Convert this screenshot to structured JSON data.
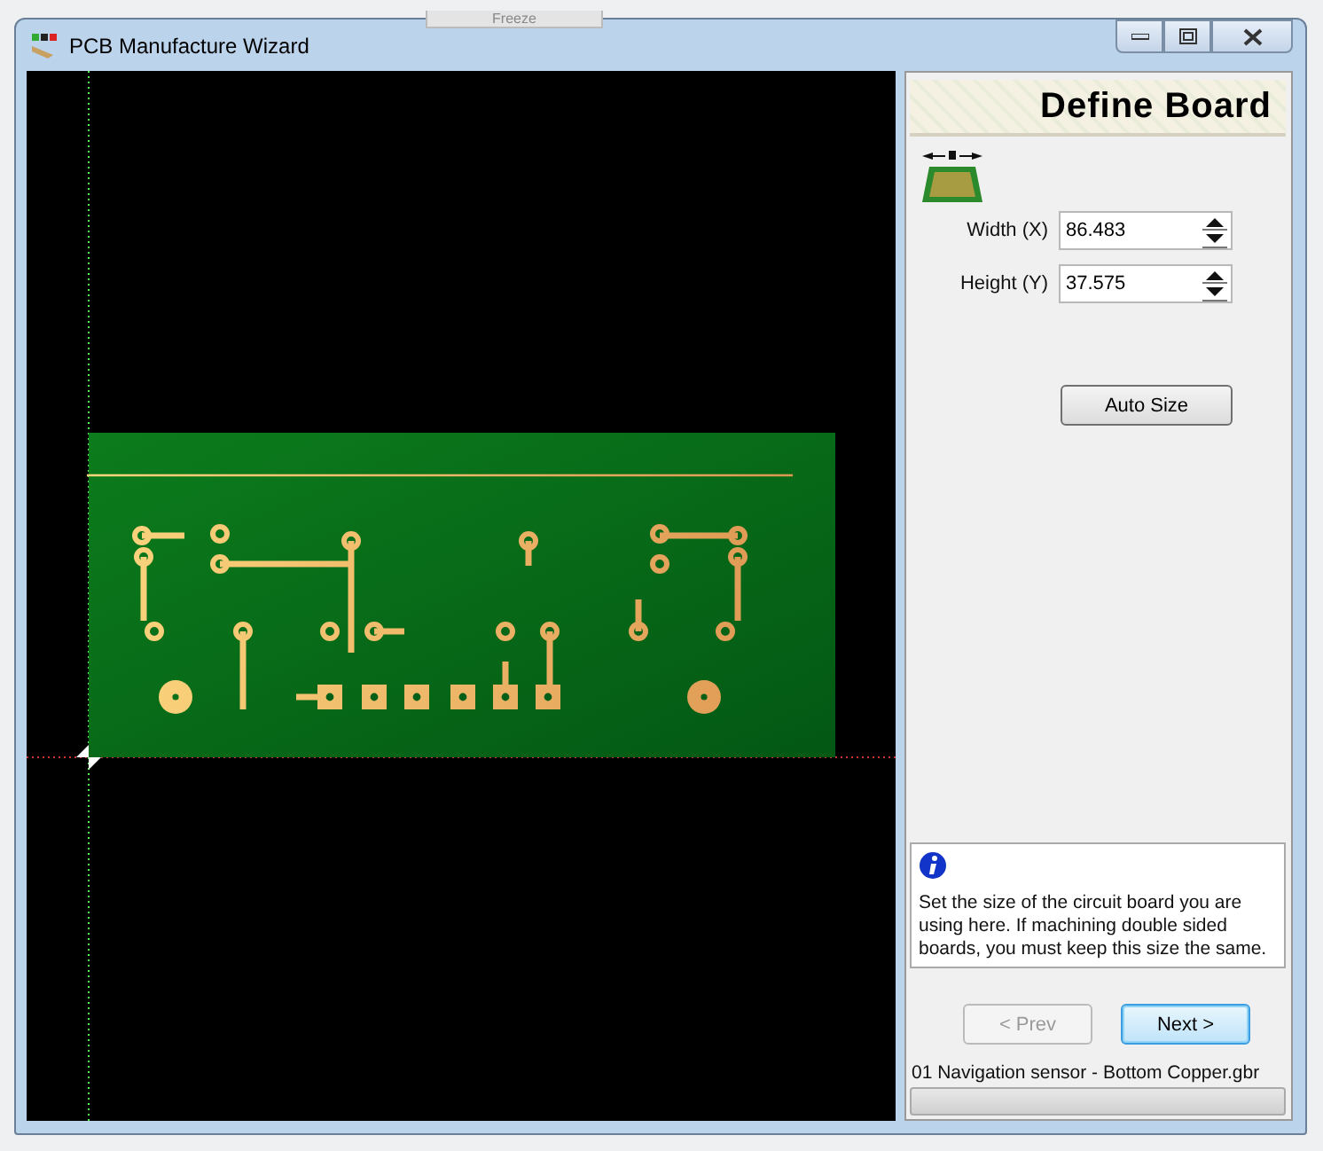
{
  "background": {
    "button": "Freeze"
  },
  "window": {
    "title": "PCB Manufacture Wizard"
  },
  "panel": {
    "title": "Define Board",
    "fields": [
      {
        "label": "Width (X)",
        "value": "86.483"
      },
      {
        "label": "Height (Y)",
        "value": "37.575"
      }
    ],
    "auto_button": "Auto Size",
    "info": "Set the size of the circuit board you are using here. If machining double sided boards, you must keep this size the same.",
    "buttons": [
      {
        "label": "< Prev",
        "disabled": true,
        "default": false
      },
      {
        "label": "Next >",
        "disabled": false,
        "default": true
      }
    ],
    "file": "01 Navigation sensor - Bottom Copper.gbr"
  }
}
